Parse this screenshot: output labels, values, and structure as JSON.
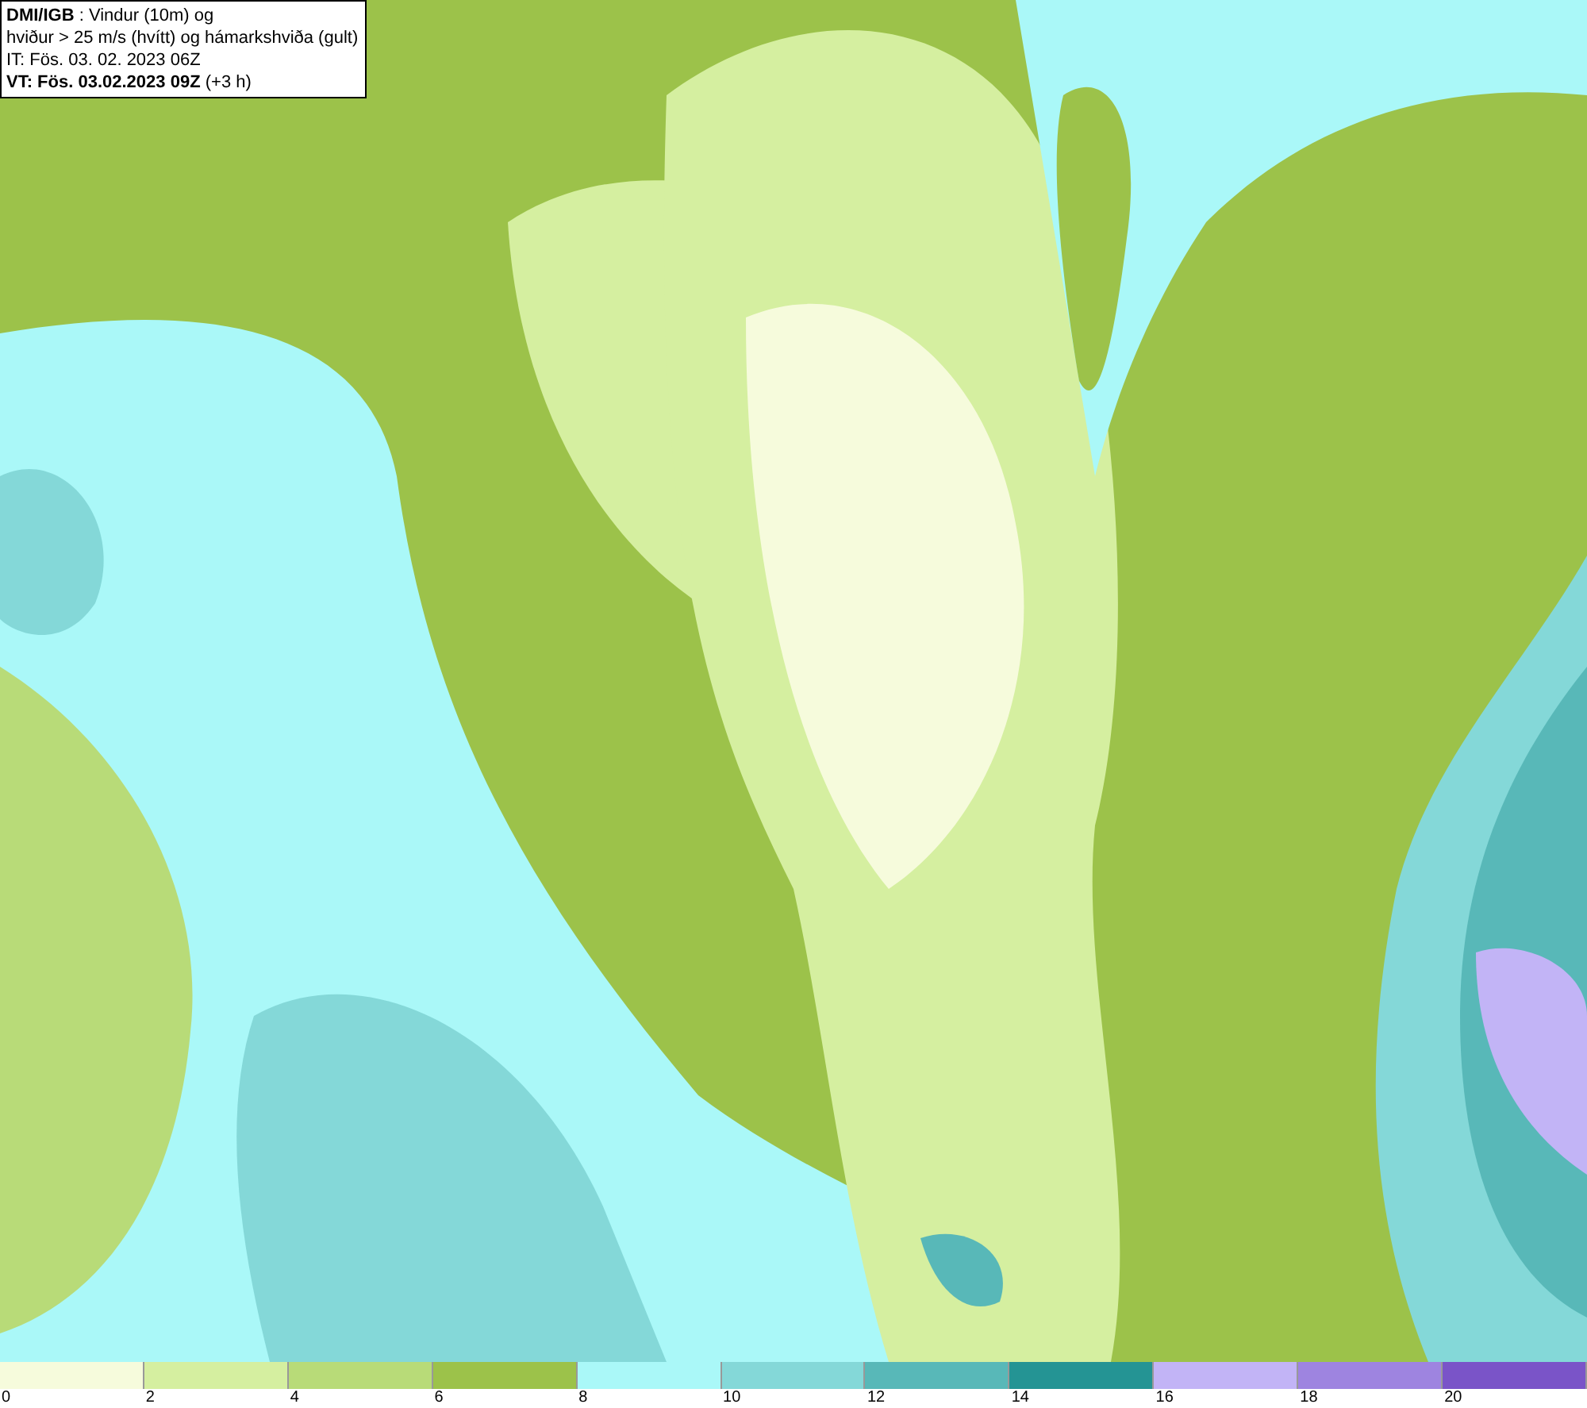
{
  "header": {
    "lines": [
      "**DMI/IGB** : Vindur (10m) og",
      "hviður > 25 m/s (hvítt) og hámarkshviða (gult)",
      "IT: Fös. 03. 02. 2023 06Z",
      "**VT: Fös. 03.02.2023 09Z** (+3 h)"
    ]
  },
  "legend": [
    {
      "label": "0",
      "color": "#f6fbdc"
    },
    {
      "label": "2",
      "color": "#d5efa0"
    },
    {
      "label": "4",
      "color": "#b8db78"
    },
    {
      "label": "6",
      "color": "#9cc24a"
    },
    {
      "label": "8",
      "color": "#aaf8f8"
    },
    {
      "label": "10",
      "color": "#84d8d8"
    },
    {
      "label": "12",
      "color": "#58b8b8"
    },
    {
      "label": "14",
      "color": "#249494"
    },
    {
      "label": "16",
      "color": "#c2b4f6"
    },
    {
      "label": "18",
      "color": "#9e84e0"
    },
    {
      "label": "20",
      "color": "#7a54c8"
    }
  ]
}
